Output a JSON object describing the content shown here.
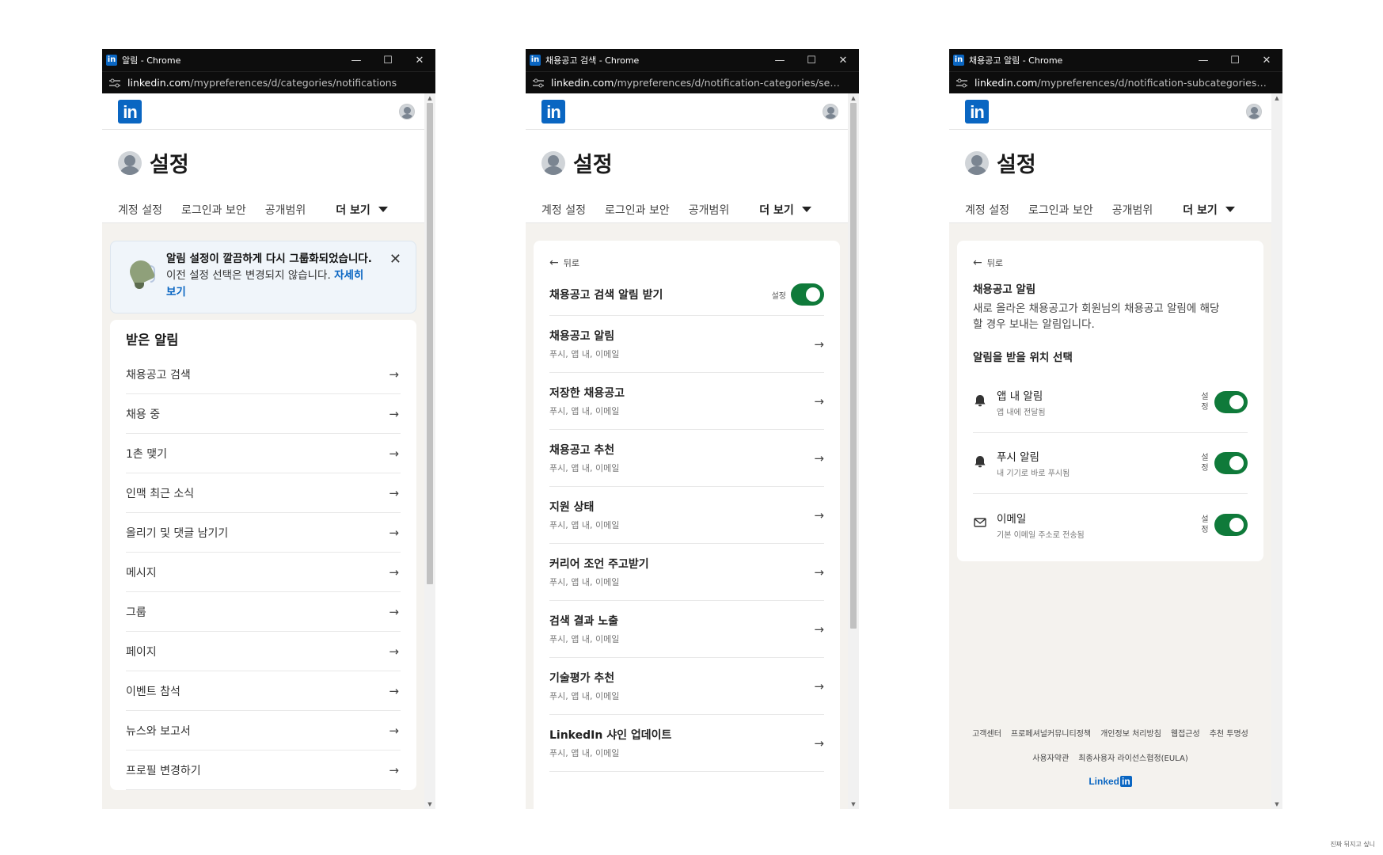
{
  "windows": [
    {
      "title": "알림 - Chrome",
      "url_host": "linkedin.com",
      "url_path": "/mypreferences/d/categories/notifications",
      "page_title": "설정",
      "tabs": [
        "계정 설정",
        "로그인과 보안",
        "공개범위"
      ],
      "more_label": "더 보기",
      "banner": {
        "line1": "알림 설정이 깔끔하게 다시 그룹화되었습니다.",
        "line2": "이전 설정 선택은 변경되지 않습니다.",
        "link": "자세히 보기"
      },
      "section_title": "받은 알림",
      "items": [
        "채용공고 검색",
        "채용 중",
        "1촌 맺기",
        "인맥 최근 소식",
        "올리기 및 댓글 남기기",
        "메시지",
        "그룹",
        "페이지",
        "이벤트 참석",
        "뉴스와 보고서",
        "프로필 변경하기"
      ]
    },
    {
      "title": "채용공고 검색 - Chrome",
      "url_host": "linkedin.com",
      "url_path": "/mypreferences/d/notification-categories/searchin…",
      "page_title": "설정",
      "tabs": [
        "계정 설정",
        "로그인과 보안",
        "공개범위"
      ],
      "more_label": "더 보기",
      "back_label": "뒤로",
      "master_label": "채용공고 검색 알림 받기",
      "master_state": "설정",
      "items": [
        {
          "title": "채용공고 알림",
          "sub": "푸시, 앱 내, 이메일"
        },
        {
          "title": "저장한 채용공고",
          "sub": "푸시, 앱 내, 이메일"
        },
        {
          "title": "채용공고 추천",
          "sub": "푸시, 앱 내, 이메일"
        },
        {
          "title": "지원 상태",
          "sub": "푸시, 앱 내, 이메일"
        },
        {
          "title": "커리어 조언 주고받기",
          "sub": "푸시, 앱 내, 이메일"
        },
        {
          "title": "검색 결과 노출",
          "sub": "푸시, 앱 내, 이메일"
        },
        {
          "title": "기술평가 추천",
          "sub": "푸시, 앱 내, 이메일"
        },
        {
          "title": "LinkedIn 샤인 업데이트",
          "sub": "푸시, 앱 내, 이메일"
        }
      ]
    },
    {
      "title": "채용공고 알림 - Chrome",
      "url_host": "linkedin.com",
      "url_path": "/mypreferences/d/notification-subcategories/job-…",
      "page_title": "설정",
      "tabs": [
        "계정 설정",
        "로그인과 보안",
        "공개범위"
      ],
      "more_label": "더 보기",
      "back_label": "뒤로",
      "detail_title": "채용공고 알림",
      "detail_desc": "새로 올라온 채용공고가 회원님의 채용공고 알림에 해당할 경우 보내는 알림입니다.",
      "section_title": "알림을 받을 위치 선택",
      "channels": [
        {
          "icon": "bell-icon",
          "name": "앱 내 알림",
          "sub": "앱 내에 전달됨",
          "state": "설정"
        },
        {
          "icon": "bell-icon",
          "name": "푸시 알림",
          "sub": "내 기기로 바로 푸시됨",
          "state": "설정"
        },
        {
          "icon": "mail-icon",
          "name": "이메일",
          "sub": "기본 이메일 주소로 전송됨",
          "state": "설정"
        }
      ],
      "footer_links_1": [
        "고객센터",
        "프로페셔널커뮤니티정책",
        "개인정보 처리방침",
        "웹접근성",
        "추천 투명성"
      ],
      "footer_links_2": [
        "사용자약관",
        "최종사용자 라이선스협정(EULA)"
      ],
      "footer_brand": "Linked",
      "footer_brand_box": "in"
    }
  ],
  "corner_note": "진짜 뒤지고 싶니",
  "colors": {
    "brand": "#0a66c2",
    "toggle_on": "#0f7a3a",
    "chrome_bar": "#0d0d0d"
  }
}
